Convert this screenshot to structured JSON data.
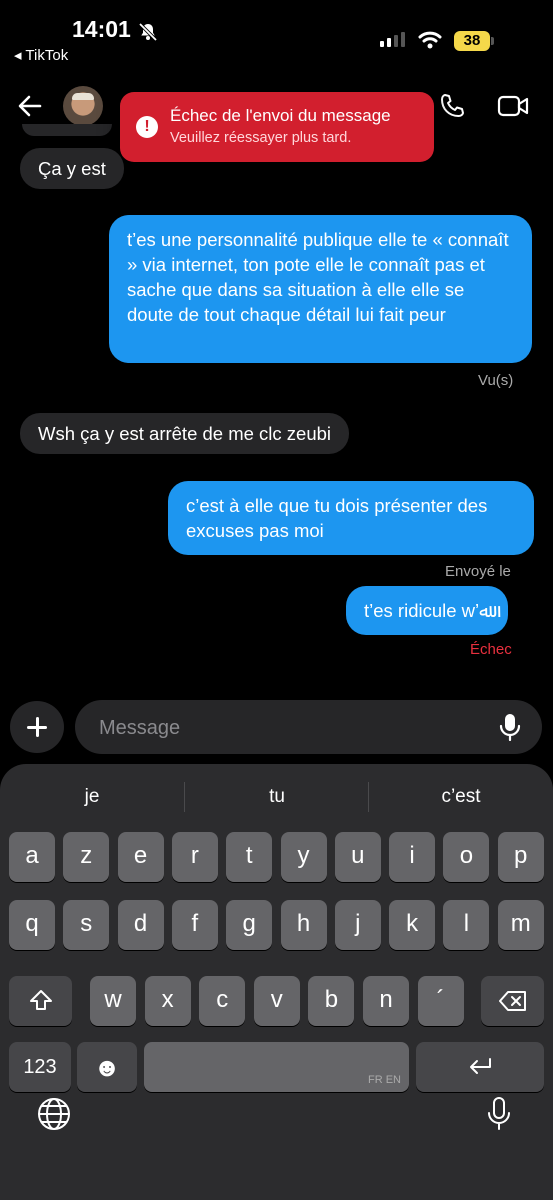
{
  "status_bar": {
    "time": "14:01",
    "back_app": "◂ TikTok",
    "battery": "38"
  },
  "toast": {
    "title": "Échec de l'envoi du message",
    "subtitle": "Veuillez réessayer plus tard.",
    "icon": "!"
  },
  "messages": [
    {
      "from": "them",
      "text": "Ça y est"
    },
    {
      "from": "me",
      "text": "t’es une personnalité publique elle te « connaît » via internet, ton pote elle le connaît pas et sache que dans sa situation à elle elle se doute de tout chaque détail lui fait peur"
    },
    {
      "from": "them",
      "text": "Wsh ça y est arrête de me clc zeubi"
    },
    {
      "from": "me",
      "text": "c’est à elle que tu dois présenter des excuses pas moi"
    },
    {
      "from": "me",
      "text": "t’es ridicule w’ﷲ"
    }
  ],
  "receipts": {
    "seen": "Vu(s)",
    "sent": "Envoyé le",
    "failed": "Échec"
  },
  "composer": {
    "placeholder": "Message"
  },
  "keyboard": {
    "suggestions": [
      "je",
      "tu",
      "c’est"
    ],
    "row1": [
      "a",
      "z",
      "e",
      "r",
      "t",
      "y",
      "u",
      "i",
      "o",
      "p"
    ],
    "row2": [
      "q",
      "s",
      "d",
      "f",
      "g",
      "h",
      "j",
      "k",
      "l",
      "m"
    ],
    "row3": [
      "w",
      "x",
      "c",
      "v",
      "b",
      "n",
      "´"
    ],
    "numbers_key": "123",
    "emoji_key": "☻",
    "space_label": "FR EN"
  },
  "colors": {
    "outgoing": "#1d96f0",
    "incoming": "#262628",
    "error": "#d21f2e",
    "battery": "#f5d84a"
  }
}
